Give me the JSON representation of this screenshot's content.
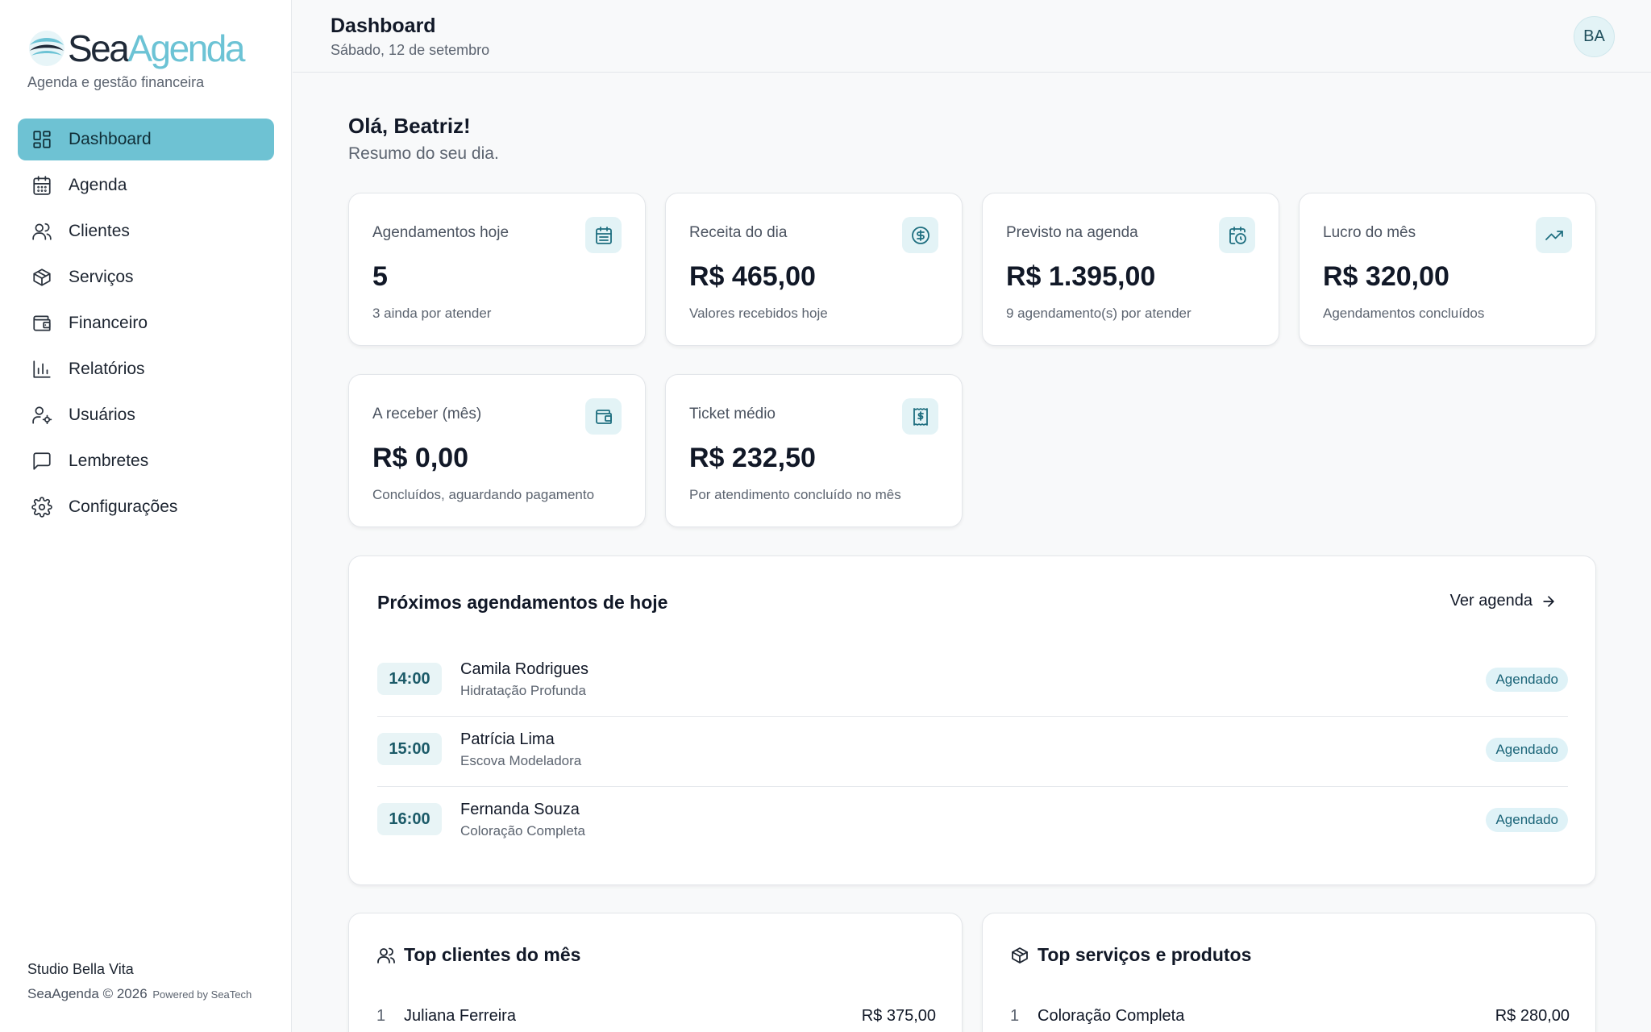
{
  "brand": {
    "name_part1": "Sea",
    "name_part2": "Agenda",
    "tagline": "Agenda e gestão financeira",
    "accent": "#6ec2d3"
  },
  "sidebar": {
    "items": [
      {
        "label": "Dashboard",
        "icon": "dashboard-icon",
        "active": true
      },
      {
        "label": "Agenda",
        "icon": "calendar-icon"
      },
      {
        "label": "Clientes",
        "icon": "users-icon"
      },
      {
        "label": "Serviços",
        "icon": "package-icon"
      },
      {
        "label": "Financeiro",
        "icon": "wallet-icon"
      },
      {
        "label": "Relatórios",
        "icon": "bar-chart-icon"
      },
      {
        "label": "Usuários",
        "icon": "user-cog-icon"
      },
      {
        "label": "Lembretes",
        "icon": "message-icon"
      },
      {
        "label": "Configurações",
        "icon": "gear-icon"
      }
    ],
    "footer": {
      "studio": "Studio Bella Vita",
      "copyright": "SeaAgenda © 2026",
      "powered": "Powered by SeaTech"
    }
  },
  "header": {
    "title": "Dashboard",
    "date": "Sábado, 12 de setembro",
    "avatar": "BA"
  },
  "greeting": {
    "title": "Olá, Beatriz!",
    "subtitle": "Resumo do seu dia."
  },
  "stats": [
    {
      "label": "Agendamentos hoje",
      "value": "5",
      "sub": "3 ainda por atender",
      "icon": "calendar-icon"
    },
    {
      "label": "Receita do dia",
      "value": "R$ 465,00",
      "sub": "Valores recebidos hoje",
      "icon": "dollar-circle-icon"
    },
    {
      "label": "Previsto na agenda",
      "value": "R$ 1.395,00",
      "sub": "9 agendamento(s) por atender",
      "icon": "calendar-clock-icon"
    },
    {
      "label": "Lucro do mês",
      "value": "R$ 320,00",
      "sub": "Agendamentos concluídos",
      "icon": "trending-up-icon"
    },
    {
      "label": "A receber (mês)",
      "value": "R$ 0,00",
      "sub": "Concluídos, aguardando pagamento",
      "icon": "wallet-icon"
    },
    {
      "label": "Ticket médio",
      "value": "R$ 232,50",
      "sub": "Por atendimento concluído no mês",
      "icon": "receipt-icon"
    }
  ],
  "upcoming": {
    "title": "Próximos agendamentos de hoje",
    "link": "Ver agenda",
    "items": [
      {
        "time": "14:00",
        "name": "Camila Rodrigues",
        "service": "Hidratação Profunda",
        "status": "Agendado"
      },
      {
        "time": "15:00",
        "name": "Patrícia Lima",
        "service": "Escova Modeladora",
        "status": "Agendado"
      },
      {
        "time": "16:00",
        "name": "Fernanda Souza",
        "service": "Coloração Completa",
        "status": "Agendado"
      }
    ]
  },
  "top_clients": {
    "title": "Top clientes do mês",
    "items": [
      {
        "rank": "1",
        "name": "Juliana Ferreira",
        "value": "R$ 375,00"
      }
    ]
  },
  "top_services": {
    "title": "Top serviços e produtos",
    "items": [
      {
        "rank": "1",
        "name": "Coloração Completa",
        "value": "R$ 280,00"
      }
    ]
  }
}
